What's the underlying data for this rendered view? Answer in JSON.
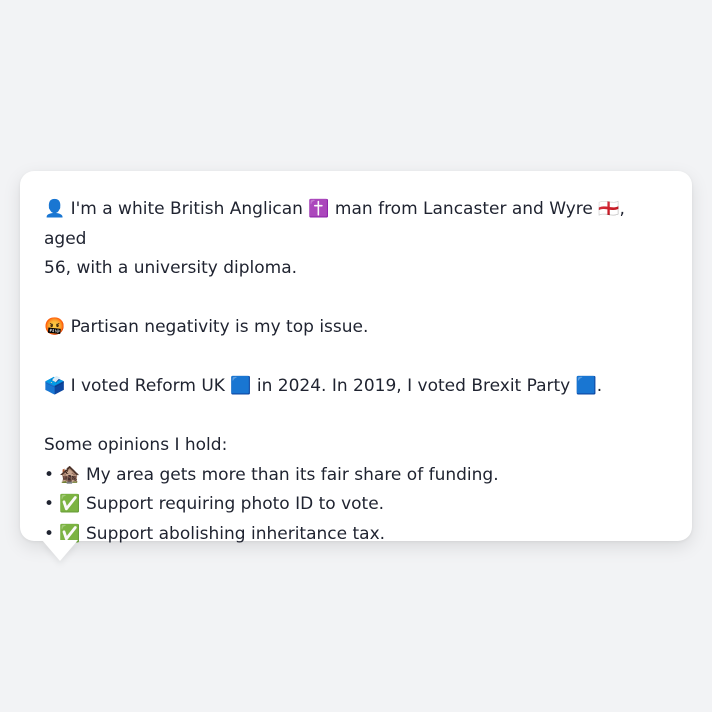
{
  "message": {
    "intro_line_1": "👤 I'm a white British Anglican ✝️ man from Lancaster and Wyre 🏴󠁧󠁢󠁥󠁮󠁧󠁿, aged",
    "intro_line_2": "56, with a university diploma.",
    "issue": "🤬 Partisan negativity is my top issue.",
    "votes": "🗳️ I voted Reform UK 🟦 in 2024. In 2019, I voted Brexit Party 🟦.",
    "opinions_heading": "Some opinions I hold:",
    "opinions": [
      "• 🏚️ My area gets more than its fair share of funding.",
      "• ✅ Support requiring photo ID to vote.",
      "• ✅ Support abolishing inheritance tax."
    ]
  }
}
